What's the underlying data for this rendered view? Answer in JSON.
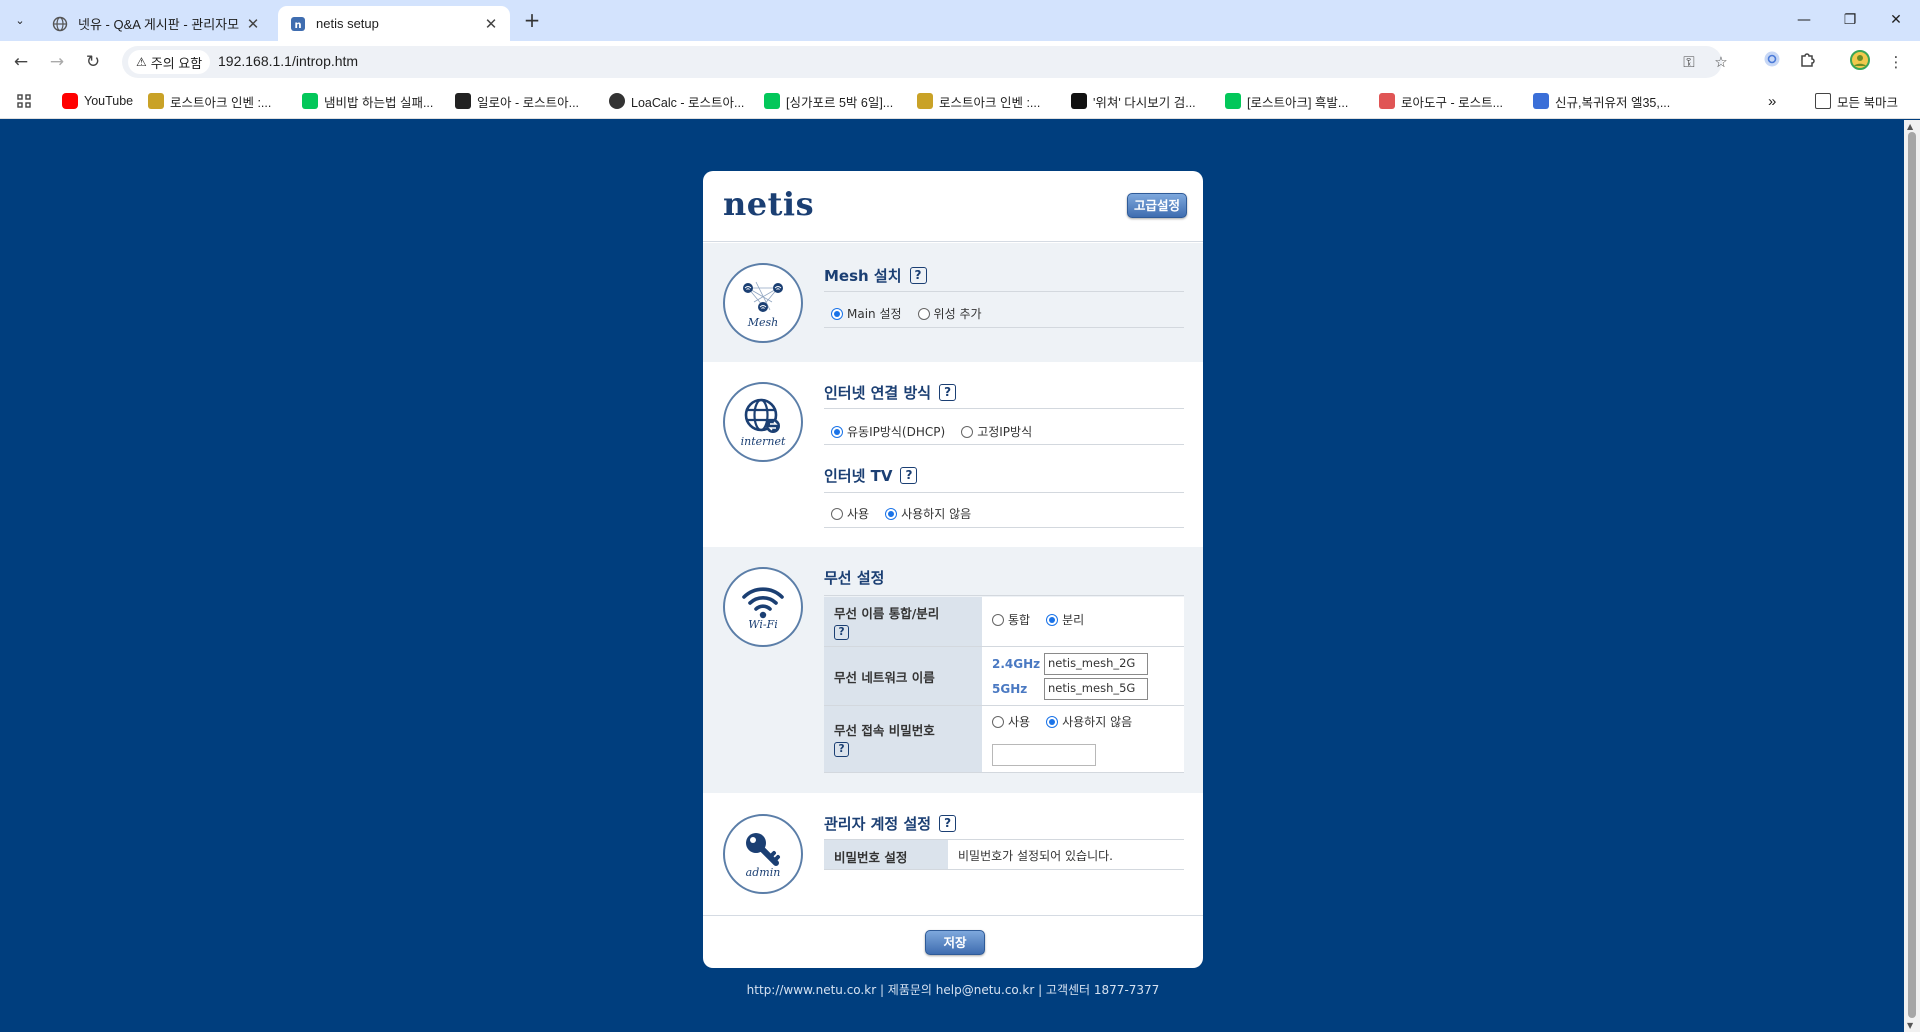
{
  "browser": {
    "tabs": [
      {
        "title": "넷유 - Q&A 게시판 - 관리자모",
        "active": false
      },
      {
        "title": "netis setup",
        "active": true
      }
    ],
    "security_chip": "주의 요함",
    "url": "192.168.1.1/introp.htm",
    "bookmarks": [
      {
        "label": "YouTube",
        "color": "#ff0000"
      },
      {
        "label": "로스트아크 인벤 :...",
        "color": "#c9a227"
      },
      {
        "label": "냄비밥 하는법 실패...",
        "color": "#03c75a"
      },
      {
        "label": "일로아 - 로스트아...",
        "color": "#222222"
      },
      {
        "label": "LoaCalc - 로스트아...",
        "color": "#333333"
      },
      {
        "label": "[싱가포르 5박 6일]...",
        "color": "#03c75a"
      },
      {
        "label": "로스트아크 인벤 :...",
        "color": "#c9a227"
      },
      {
        "label": "'위쳐' 다시보기 검...",
        "color": "#111111"
      },
      {
        "label": "[로스트아크] 흑발...",
        "color": "#03c75a"
      },
      {
        "label": "로아도구 - 로스트...",
        "color": "#e05555"
      },
      {
        "label": "신규,복귀유저 엘35,...",
        "color": "#3b6fd8"
      }
    ],
    "all_bookmarks": "모든 북마크"
  },
  "setup": {
    "logo": "netis",
    "advanced_button": "고급설정",
    "mesh": {
      "icon_label": "Mesh",
      "title": "Mesh 설치",
      "options": [
        "Main 설정",
        "위성 추가"
      ],
      "selected": 0
    },
    "internet": {
      "icon_label": "internet",
      "title": "인터넷 연결 방식",
      "options": [
        "유동IP방식(DHCP)",
        "고정IP방식"
      ],
      "selected": 0,
      "tv_title": "인터넷 TV",
      "tv_options": [
        "사용",
        "사용하지 않음"
      ],
      "tv_selected": 1
    },
    "wifi": {
      "icon_label": "Wi-Fi",
      "title": "무선 설정",
      "name_mode_label": "무선 이름 통합/분리",
      "name_mode_options": [
        "통합",
        "분리"
      ],
      "name_mode_selected": 1,
      "network_name_label": "무선 네트워크 이름",
      "band_24": "2.4GHz",
      "ssid_24": "netis_mesh_2G",
      "band_5": "5GHz",
      "ssid_5": "netis_mesh_5G",
      "password_label": "무선 접속 비밀번호",
      "password_options": [
        "사용",
        "사용하지 않음"
      ],
      "password_selected": 1,
      "password_value": ""
    },
    "admin": {
      "icon_label": "admin",
      "title": "관리자 계정 설정",
      "password_label": "비밀번호 설정",
      "password_status": "비밀번호가 설정되어 있습니다."
    },
    "save_button": "저장",
    "footer": "http://www.netu.co.kr | 제품문의 help@netu.co.kr | 고객센터 1877-7377"
  }
}
